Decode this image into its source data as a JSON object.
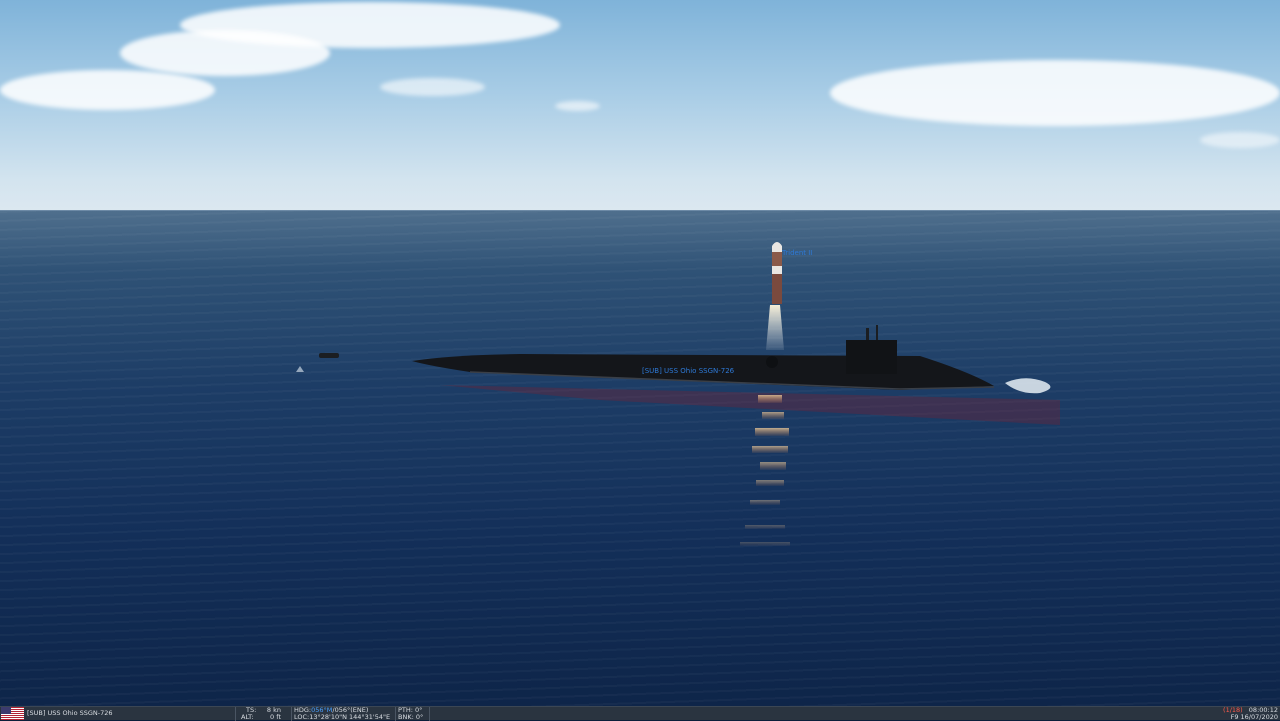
{
  "scene": {
    "missile_label": "Trident II",
    "submarine_label": "[SUB] USS Ohio SSGN-726"
  },
  "status_bar": {
    "unit_name": "[SUB] USS Ohio SSGN-726",
    "ts_label": "TS:",
    "ts_value": "8",
    "ts_unit": "kn",
    "alt_label": "ALT:",
    "alt_value": "0",
    "alt_unit": "ft",
    "hdg_label": "HDG:",
    "hdg_magnetic": "056°M",
    "hdg_true": "/056°(ENE)",
    "loc_label": "LOC:",
    "loc_value": "13°28'10\"N 144°31'54\"E",
    "pth_label": "PTH:",
    "pth_value": "0°",
    "bnk_label": "BNK:",
    "bnk_value": "0°",
    "unit_index": "(1/18)",
    "time": "08:00:12",
    "date": "F9 16/07/2020"
  },
  "colors": {
    "label_blue": "#2e79d6",
    "status_bg": "#2a3440",
    "highlight_blue": "#4aa0ff",
    "index_red": "#ff5a4a"
  }
}
